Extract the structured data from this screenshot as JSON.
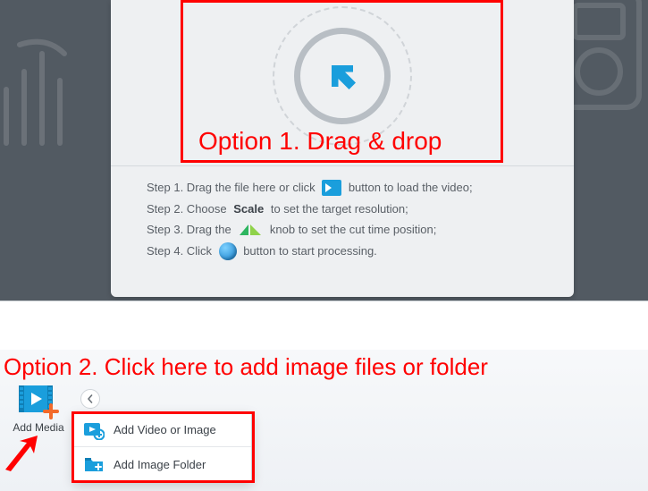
{
  "annotations": {
    "option1": "Option 1. Drag & drop",
    "option2": "Option 2. Click here to add image files or folder"
  },
  "steps": {
    "s1a": "Step 1. Drag the file here or click ",
    "s1b": " button to load the video;",
    "s2a": "Step 2. Choose ",
    "s2_scale": "Scale",
    "s2b": " to set the target resolution;",
    "s3a": "Step 3. Drag the ",
    "s3b": " knob to set the cut time position;",
    "s4a": "Step 4. Click ",
    "s4b": " button to start processing."
  },
  "toolbar": {
    "add_media": "Add Media"
  },
  "menu": {
    "add_video_or_image": "Add Video or Image",
    "add_image_folder": "Add Image Folder"
  }
}
